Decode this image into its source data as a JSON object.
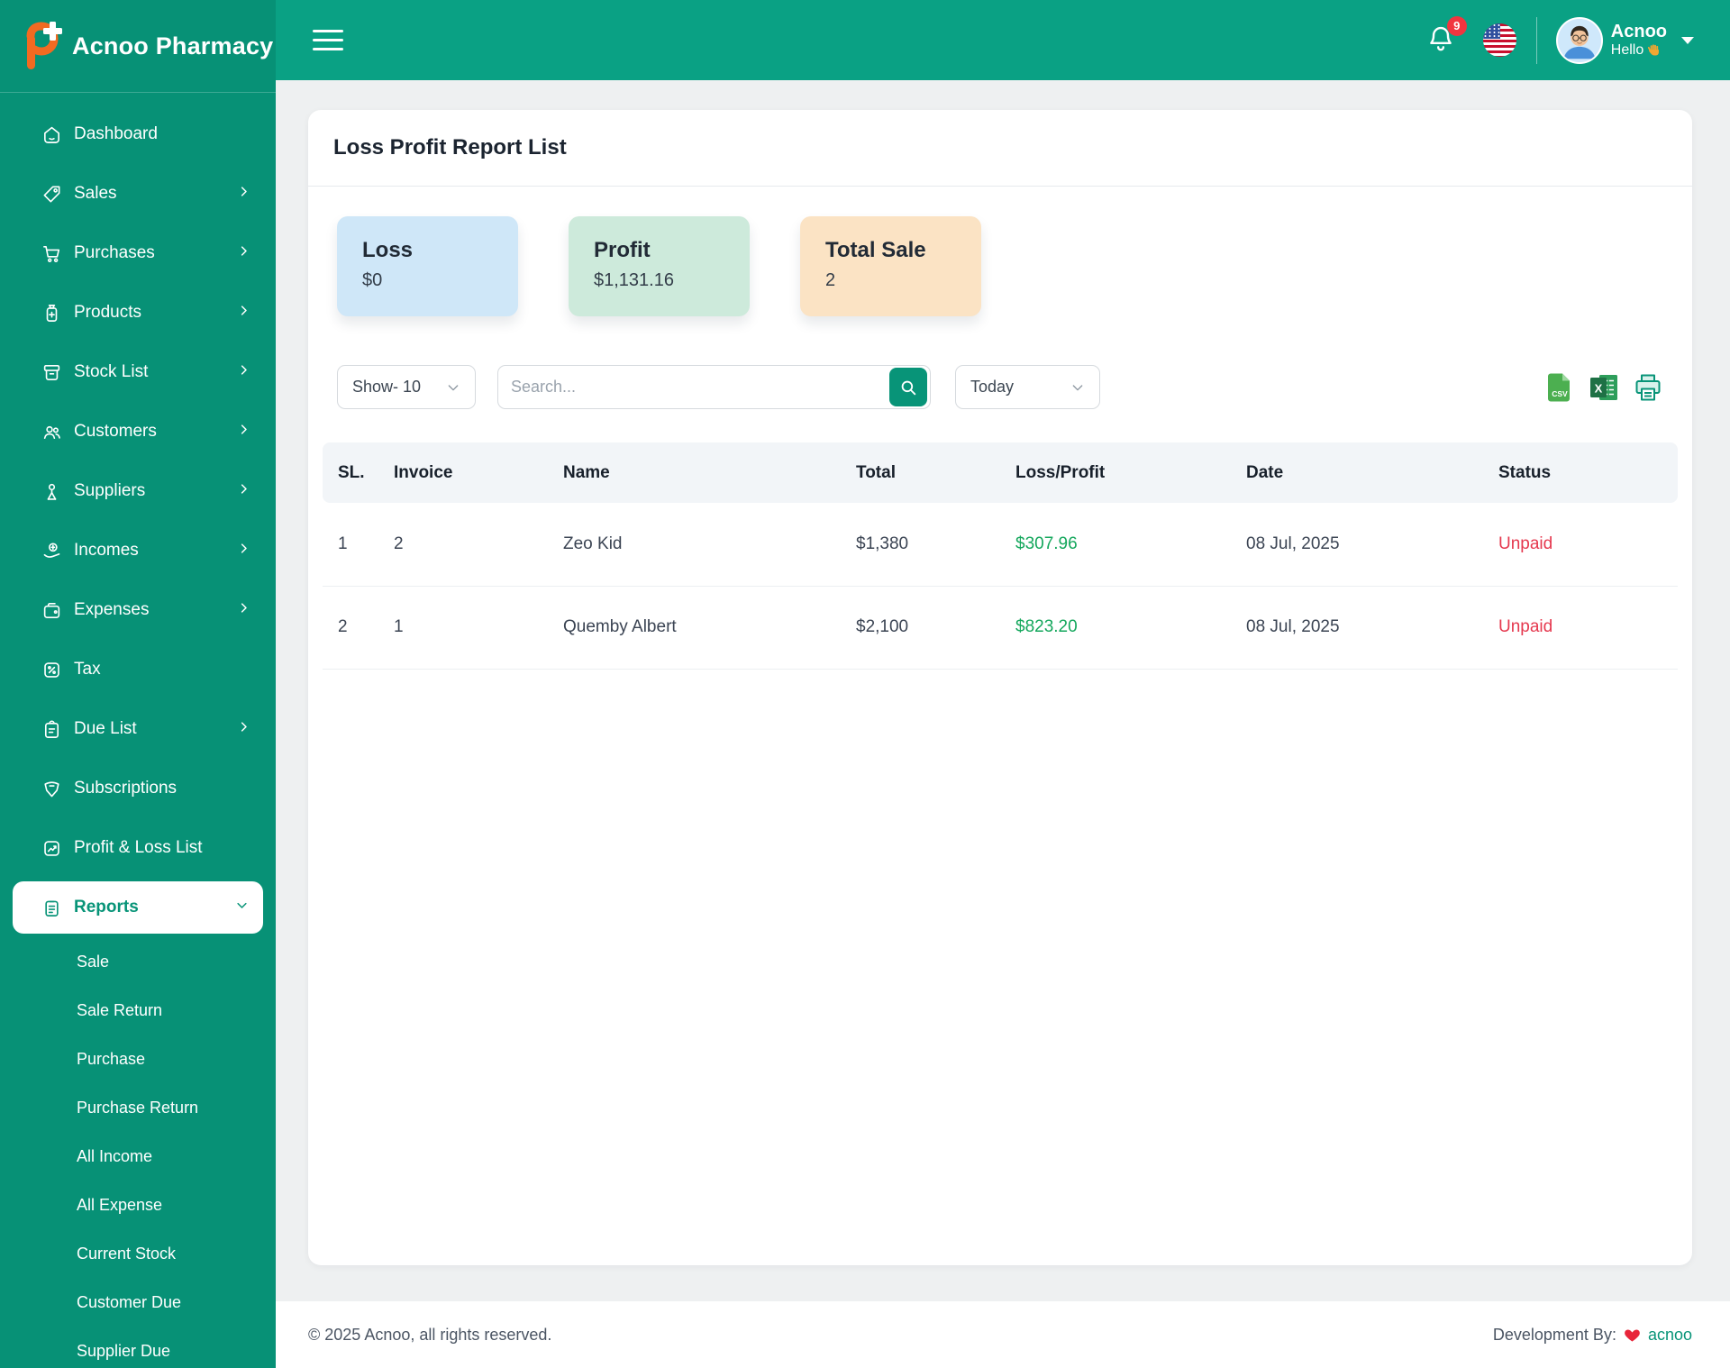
{
  "brand": {
    "name": "Acnoo Pharmacy"
  },
  "header": {
    "notification_count": "9",
    "user": {
      "name": "Acnoo",
      "greeting": "Hello"
    }
  },
  "sidebar": {
    "items": [
      {
        "label": "Dashboard"
      },
      {
        "label": "Sales"
      },
      {
        "label": "Purchases"
      },
      {
        "label": "Products"
      },
      {
        "label": "Stock List"
      },
      {
        "label": "Customers"
      },
      {
        "label": "Suppliers"
      },
      {
        "label": "Incomes"
      },
      {
        "label": "Expenses"
      },
      {
        "label": "Tax"
      },
      {
        "label": "Due List"
      },
      {
        "label": "Subscriptions"
      },
      {
        "label": "Profit & Loss List"
      },
      {
        "label": "Reports"
      }
    ],
    "report_subitems": [
      "Sale",
      "Sale Return",
      "Purchase",
      "Purchase Return",
      "All Income",
      "All Expense",
      "Current Stock",
      "Customer Due",
      "Supplier Due"
    ]
  },
  "page": {
    "title": "Loss Profit Report List"
  },
  "summary_cards": [
    {
      "label": "Loss",
      "value": "$0"
    },
    {
      "label": "Profit",
      "value": "$1,131.16"
    },
    {
      "label": "Total Sale",
      "value": "2"
    }
  ],
  "controls": {
    "show_label": "Show- 10",
    "search_placeholder": "Search...",
    "date_filter": "Today",
    "export_icons": [
      "csv-file-icon",
      "excel-file-icon",
      "printer-icon"
    ],
    "csv_label": "CSV"
  },
  "table": {
    "columns": [
      "SL.",
      "Invoice",
      "Name",
      "Total",
      "Loss/Profit",
      "Date",
      "Status"
    ],
    "rows": [
      {
        "sl": "1",
        "invoice": "2",
        "name": "Zeo Kid",
        "total": "$1,380",
        "loss_profit": "$307.96",
        "date": "08 Jul, 2025",
        "status": "Unpaid"
      },
      {
        "sl": "2",
        "invoice": "1",
        "name": "Quemby Albert",
        "total": "$2,100",
        "loss_profit": "$823.20",
        "date": "08 Jul, 2025",
        "status": "Unpaid"
      }
    ]
  },
  "footer": {
    "copyright": "© 2025 Acnoo, all rights reserved.",
    "dev_label": "Development By:",
    "dev_link": "acnoo"
  },
  "colors": {
    "accent": "#089478",
    "header_bg": "#0aa184",
    "sidebar_bg": "#079176",
    "page_bg": "#eef0f1",
    "loss_card_bg": "#cfe7f8",
    "profit_card_bg": "#cdeadb",
    "sale_card_bg": "#fbe3c4",
    "profit_text": "#14a75c",
    "unpaid_text": "#e5394f",
    "table_header_bg": "#f2f5f8",
    "border": "#e6e9ed",
    "text_dark": "#1b2430",
    "text_muted": "#5d6673",
    "badge_red": "#f1353f",
    "logo_orange": "#f26a21"
  }
}
